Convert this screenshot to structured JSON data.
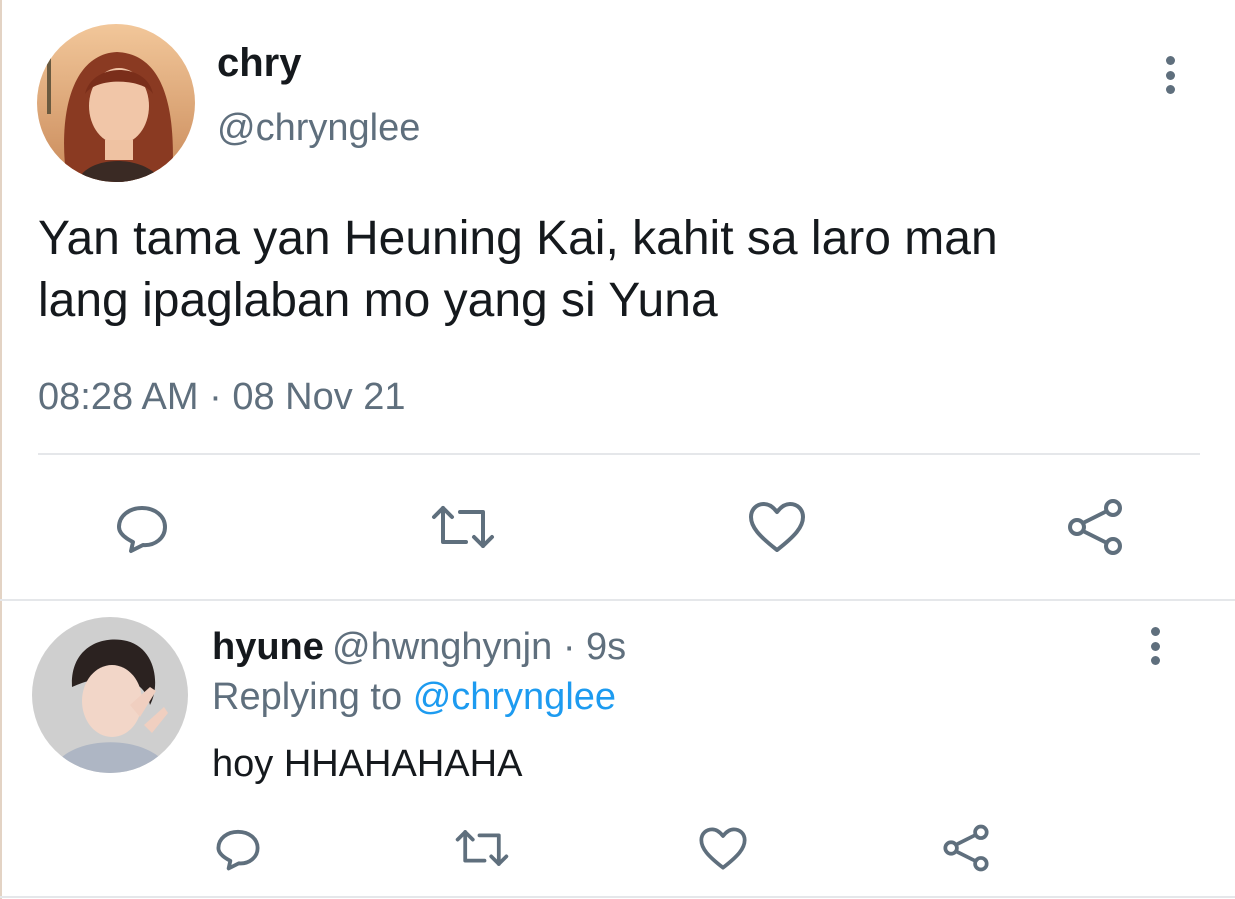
{
  "main_tweet": {
    "author_name": "chry",
    "author_handle": "@chrynglee",
    "text_line_1": "Yan tama yan Heuning Kai, kahit sa laro man",
    "text_line_2": "lang ipaglaban mo yang si Yuna",
    "timestamp": "08:28 AM · 08 Nov 21",
    "actions": [
      "reply-icon",
      "retweet-icon",
      "like-icon",
      "share-icon"
    ]
  },
  "reply": {
    "author_name": "hyune",
    "author_handle": "@hwnghynjn · 9s",
    "replying_to_prefix": "Replying to",
    "replying_to_handle": "@chrynglee",
    "text": "hoy HHAHAHAHA",
    "actions": [
      "reply-icon",
      "retweet-icon",
      "like-icon",
      "share-icon"
    ]
  },
  "colors": {
    "text": "#15191d",
    "muted": "#5f6f7d",
    "link": "#1d9bf0",
    "divider": "#e5e7ea"
  }
}
